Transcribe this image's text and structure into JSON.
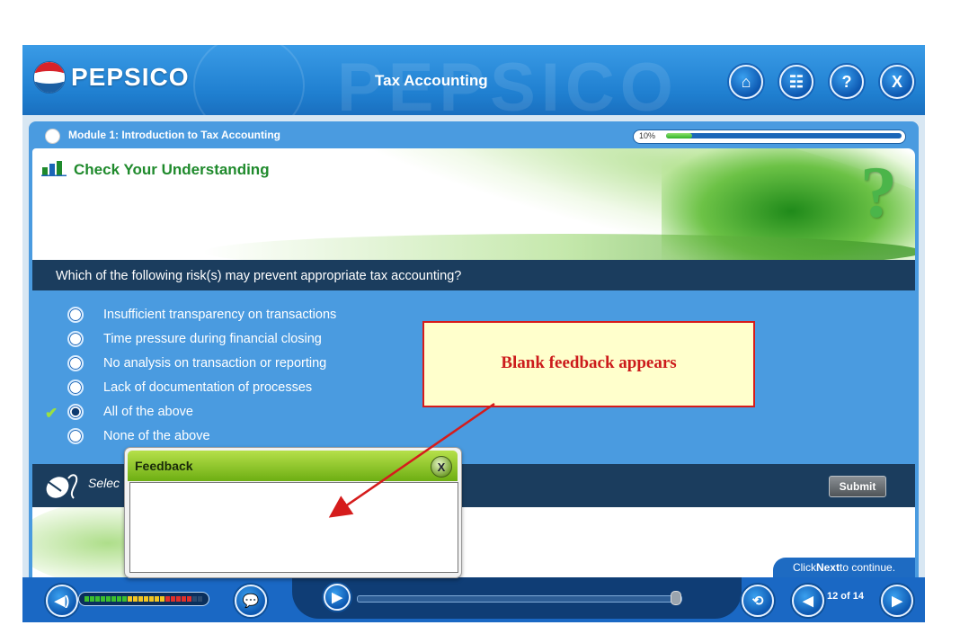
{
  "header": {
    "brand": "PEPSICO",
    "watermark": "PEPSICO",
    "course_title": "Tax Accounting",
    "buttons": [
      {
        "name": "home-button",
        "icon": "home-icon",
        "glyph": "⌂"
      },
      {
        "name": "sitemap-button",
        "icon": "sitemap-icon",
        "glyph": "☷"
      },
      {
        "name": "help-button",
        "icon": "help-icon",
        "glyph": "?"
      },
      {
        "name": "exit-button",
        "icon": "close-icon",
        "glyph": "X"
      }
    ]
  },
  "module": {
    "title": "Module 1: Introduction to Tax Accounting",
    "progress_label": "10%",
    "progress": 0.1
  },
  "banner": {
    "title": "Check Your Understanding",
    "symbol": "?"
  },
  "question": {
    "text": "Which of the following risk(s) may prevent appropriate tax accounting?",
    "options": [
      {
        "label": "Insufficient transparency on transactions",
        "selected": false
      },
      {
        "label": "Time pressure during financial closing",
        "selected": false
      },
      {
        "label": "No analysis on transaction or reporting",
        "selected": false
      },
      {
        "label": "Lack of documentation of processes",
        "selected": false
      },
      {
        "label": "All of the above",
        "selected": true
      },
      {
        "label": "None of the above",
        "selected": false
      }
    ],
    "correct_mark": "✔"
  },
  "instruction": {
    "text": "Selec",
    "submit_label": "Submit"
  },
  "feedback": {
    "title": "Feedback",
    "close_label": "X",
    "body": ""
  },
  "annotation": {
    "text": "Blank feedback appears"
  },
  "footer": {
    "click_next_pre": "Click ",
    "click_next_bold": "Next",
    "click_next_post": " to continue.",
    "page_count": "12 of 14",
    "volume_level": 0.9,
    "timeline_position": 0.98
  },
  "colors": {
    "header_blue": "#1f7fd0",
    "dark_bar": "#1b3d5e",
    "feedback_green": "#6dae13",
    "callout_red": "#d51c1c",
    "callout_fill": "#ffffcc"
  }
}
